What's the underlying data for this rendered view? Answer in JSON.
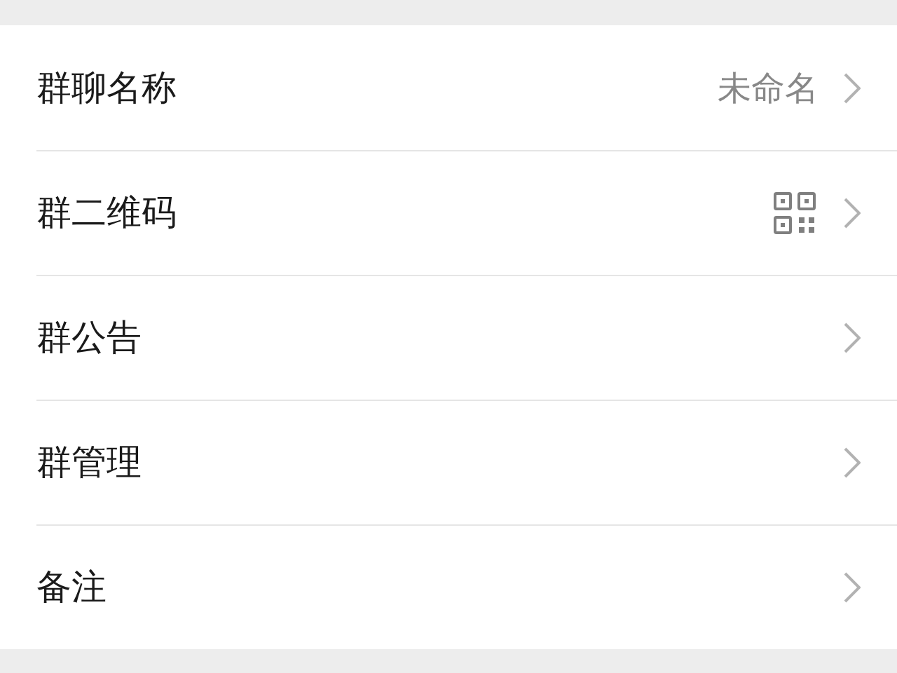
{
  "rows": [
    {
      "label": "群聊名称",
      "kind": "text",
      "value": "未命名"
    },
    {
      "label": "群二维码",
      "kind": "qr"
    },
    {
      "label": "群公告",
      "kind": "plain"
    },
    {
      "label": "群管理",
      "kind": "plain"
    },
    {
      "label": "备注",
      "kind": "plain"
    }
  ]
}
